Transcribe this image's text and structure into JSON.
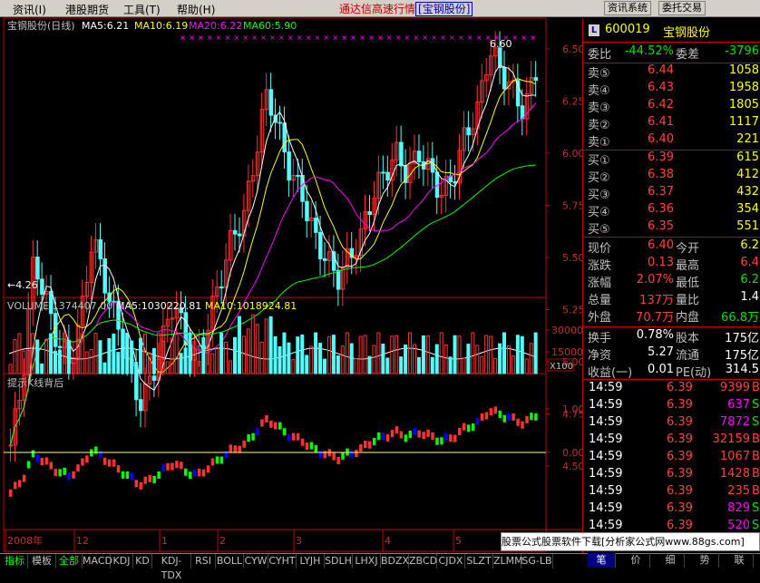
{
  "menu": {
    "items": [
      "资讯(I)",
      "港股期货",
      "工具(T)",
      "帮助(H)"
    ],
    "title_prefix": "通达信高速行情",
    "title_tag": "[宝钢股份]",
    "buttons": [
      "资讯系统",
      "委托交易"
    ]
  },
  "chart": {
    "name": "宝钢股份(日线)",
    "ma5_label": "MA5:6.21",
    "ma10_label": "MA10:6.19",
    "ma20_label": "MA20:6.22",
    "ma60_label": "MA60:5.90",
    "price_ticks": [
      "6.50",
      "6.25",
      "6.00",
      "5.75",
      "5.50",
      "5.25",
      "5.00",
      "4.75",
      "4.50"
    ],
    "high_label": "6.60",
    "low_label": "←4.26",
    "volume_title": "VOLUME:1374407.00",
    "vol_ma5": "MA5:1030220.81",
    "vol_ma10": "MA10:1018924.81",
    "vol_ticks": [
      "30000",
      "15000"
    ],
    "vol_unit": "X100",
    "indicator_title": "提示K线背后",
    "ind_ticks": [
      "1.00",
      "0.00"
    ],
    "date_labels": [
      "2008年",
      "12",
      "1",
      "2",
      "3",
      "4",
      "5"
    ],
    "colors": {
      "up": "#ff3232",
      "down": "#54fcfc",
      "ma5": "#ffffff",
      "ma10": "#ffff00",
      "ma20": "#ff00ff",
      "ma60": "#00ff00",
      "border": "#c00000"
    }
  },
  "quote": {
    "code": "600019",
    "name": "宝钢股份",
    "weibi_label": "委比",
    "weibi": "-44.52%",
    "weicha_label": "委差",
    "weicha": "-3796",
    "asks": [
      {
        "label": "卖⑤",
        "price": "6.44",
        "vol": "1058"
      },
      {
        "label": "卖④",
        "price": "6.43",
        "vol": "1958"
      },
      {
        "label": "卖③",
        "price": "6.42",
        "vol": "1805"
      },
      {
        "label": "卖②",
        "price": "6.41",
        "vol": "1117"
      },
      {
        "label": "卖①",
        "price": "6.40",
        "vol": "221"
      }
    ],
    "bids": [
      {
        "label": "买①",
        "price": "6.39",
        "vol": "615"
      },
      {
        "label": "买②",
        "price": "6.38",
        "vol": "412"
      },
      {
        "label": "买③",
        "price": "6.37",
        "vol": "432"
      },
      {
        "label": "买④",
        "price": "6.36",
        "vol": "354"
      },
      {
        "label": "买⑤",
        "price": "6.35",
        "vol": "551"
      }
    ],
    "stats": [
      {
        "l1": "现价",
        "v1": "6.40",
        "l2": "今开",
        "v2": "6.2"
      },
      {
        "l1": "涨跌",
        "v1": "0.13",
        "l2": "最高",
        "v2": "6.4"
      },
      {
        "l1": "涨幅",
        "v1": "2.07%",
        "l2": "最低",
        "v2": "6.2"
      },
      {
        "l1": "总量",
        "v1": "137万",
        "l2": "量比",
        "v2": "1.4"
      },
      {
        "l1": "外盘",
        "v1": "70.7万",
        "l2": "内盘",
        "v2": "66.8万"
      }
    ],
    "stats2": [
      {
        "l1": "换手",
        "v1": "0.78%",
        "l2": "股本",
        "v2": "175亿"
      },
      {
        "l1": "净资",
        "v1": "5.27",
        "l2": "流通",
        "v2": "175亿"
      },
      {
        "l1": "收益(一)",
        "v1": "0.01",
        "l2": "PE(动)",
        "v2": "314.5"
      }
    ],
    "ticks": [
      {
        "time": "14:59",
        "price": "6.39",
        "vol": "9399",
        "flag": "B"
      },
      {
        "time": "14:59",
        "price": "6.39",
        "vol": "637",
        "flag": "S"
      },
      {
        "time": "14:59",
        "price": "6.39",
        "vol": "7872",
        "flag": "S"
      },
      {
        "time": "14:59",
        "price": "6.39",
        "vol": "32159",
        "flag": "B"
      },
      {
        "time": "14:59",
        "price": "6.39",
        "vol": "1067",
        "flag": "B"
      },
      {
        "time": "14:59",
        "price": "6.39",
        "vol": "1428",
        "flag": "B"
      },
      {
        "time": "14:59",
        "price": "6.39",
        "vol": "235",
        "flag": "B"
      },
      {
        "time": "14:59",
        "price": "6.39",
        "vol": "829",
        "flag": "S"
      },
      {
        "time": "14:59",
        "price": "6.39",
        "vol": "520",
        "flag": "S"
      },
      {
        "time": "14:59",
        "price": "6.39",
        "vol": "",
        "flag": ""
      }
    ]
  },
  "tabs": [
    "指标",
    "模板",
    "全部",
    "MACD",
    "KDJ",
    "KD",
    "KDJ-TDX",
    "RSI",
    "BOLL",
    "CYW",
    "CYHT",
    "LYJH",
    "SDLH",
    "LHXJ",
    "BDZX",
    "ZBCD",
    "CJDX",
    "SLZT",
    "ZLMM",
    "SG-LB"
  ],
  "right_tabs": [
    "笔",
    "价",
    "细",
    "势",
    "联"
  ],
  "watermark": "股票公式股票软件下载[分析家公式网www.88gs.com]"
}
